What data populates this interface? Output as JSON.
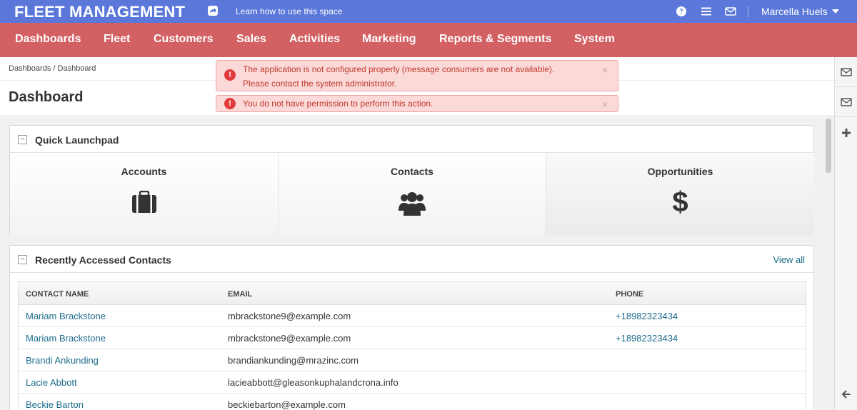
{
  "topbar": {
    "brand": "FLEET MANAGEMENT",
    "learn_link": "Learn how to use this space",
    "user_name": "Marcella Huels"
  },
  "nav": {
    "items": [
      {
        "label": "Dashboards"
      },
      {
        "label": "Fleet"
      },
      {
        "label": "Customers"
      },
      {
        "label": "Sales"
      },
      {
        "label": "Activities"
      },
      {
        "label": "Marketing"
      },
      {
        "label": "Reports & Segments"
      },
      {
        "label": "System"
      }
    ]
  },
  "breadcrumb": {
    "root": "Dashboards",
    "separator": "/",
    "current": "Dashboard"
  },
  "page": {
    "title": "Dashboard"
  },
  "alerts": [
    {
      "line1": "The application is not configured properly (message consumers are not available).",
      "line2": "Please contact the system administrator."
    },
    {
      "line1": "You do not have permission to perform this action."
    }
  ],
  "alert_close": "×",
  "launchpad": {
    "title": "Quick Launchpad",
    "collapse": "−",
    "tiles": [
      {
        "label": "Accounts",
        "icon": "briefcase-icon"
      },
      {
        "label": "Contacts",
        "icon": "users-icon"
      },
      {
        "label": "Opportunities",
        "icon": "dollar-icon"
      }
    ],
    "dollar_glyph": "$"
  },
  "contacts": {
    "title": "Recently Accessed Contacts",
    "collapse": "−",
    "view_all": "View all",
    "columns": [
      "CONTACT NAME",
      "EMAIL",
      "PHONE"
    ],
    "rows": [
      {
        "name": "Mariam Brackstone",
        "email": "mbrackstone9@example.com",
        "phone": "+18982323434"
      },
      {
        "name": "Mariam Brackstone",
        "email": "mbrackstone9@example.com",
        "phone": "+18982323434"
      },
      {
        "name": "Brandi Ankunding",
        "email": "brandiankunding@mrazinc.com",
        "phone": ""
      },
      {
        "name": "Lacie Abbott",
        "email": "lacieabbott@gleasonkuphalandcrona.info",
        "phone": ""
      },
      {
        "name": "Beckie Barton",
        "email": "beckiebarton@example.com",
        "phone": ""
      }
    ]
  },
  "colors": {
    "topbar": "#5a77d9",
    "mainnav": "#d36062",
    "link": "#1c6b8a",
    "alert_bg": "#fbd9d9",
    "alert_text": "#c0392b"
  }
}
